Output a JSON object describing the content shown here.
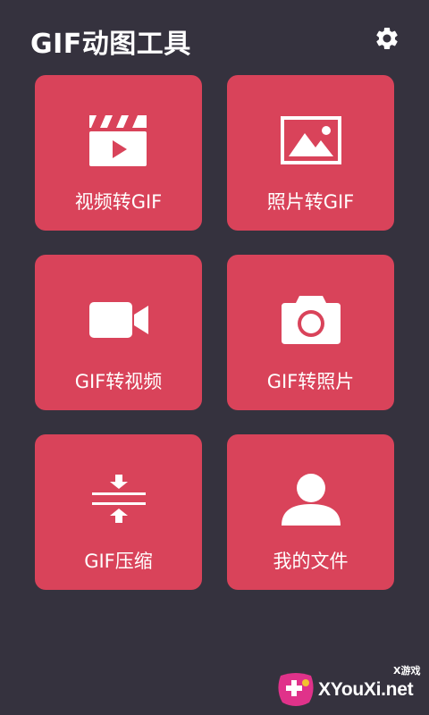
{
  "header": {
    "title": "GIF动图工具",
    "settings_icon": "gear-icon"
  },
  "tiles": [
    {
      "label": "视频转GIF",
      "icon": "clapperboard-icon"
    },
    {
      "label": "照片转GIF",
      "icon": "image-icon"
    },
    {
      "label": "GIF转视频",
      "icon": "video-camera-icon"
    },
    {
      "label": "GIF转照片",
      "icon": "camera-icon"
    },
    {
      "label": "GIF压缩",
      "icon": "compress-icon"
    },
    {
      "label": "我的文件",
      "icon": "user-icon"
    }
  ],
  "watermark": {
    "top": "X游戏",
    "text": "XYouXi.net"
  },
  "colors": {
    "background": "#35323e",
    "tile": "#d9435a",
    "foreground": "#ffffff"
  }
}
